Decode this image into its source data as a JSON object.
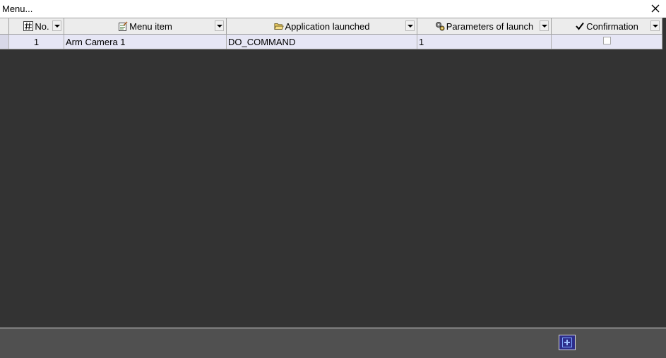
{
  "window": {
    "title": "Menu..."
  },
  "icons": {
    "close": "close-icon",
    "no": "hash-icon",
    "menu_item": "menu-edit-icon",
    "application": "folder-open-icon",
    "parameters": "gears-icon",
    "confirmation": "checkmark-icon",
    "add": "add-plus-icon"
  },
  "colors": {
    "background": "#333333",
    "header": "#ececec",
    "selected_row": "#e6e6f5",
    "footer": "#505050",
    "add_button": "#2d2d8a"
  },
  "table": {
    "columns": [
      {
        "key": "no",
        "label": "No."
      },
      {
        "key": "menu_item",
        "label": "Menu item"
      },
      {
        "key": "application",
        "label": "Application launched"
      },
      {
        "key": "parameters",
        "label": "Parameters of launch"
      },
      {
        "key": "confirmation",
        "label": "Confirmation"
      }
    ],
    "rows": [
      {
        "no": "1",
        "menu_item": "Arm Camera 1",
        "application": "DO_COMMAND",
        "parameters": "1",
        "confirmation": false
      }
    ]
  }
}
